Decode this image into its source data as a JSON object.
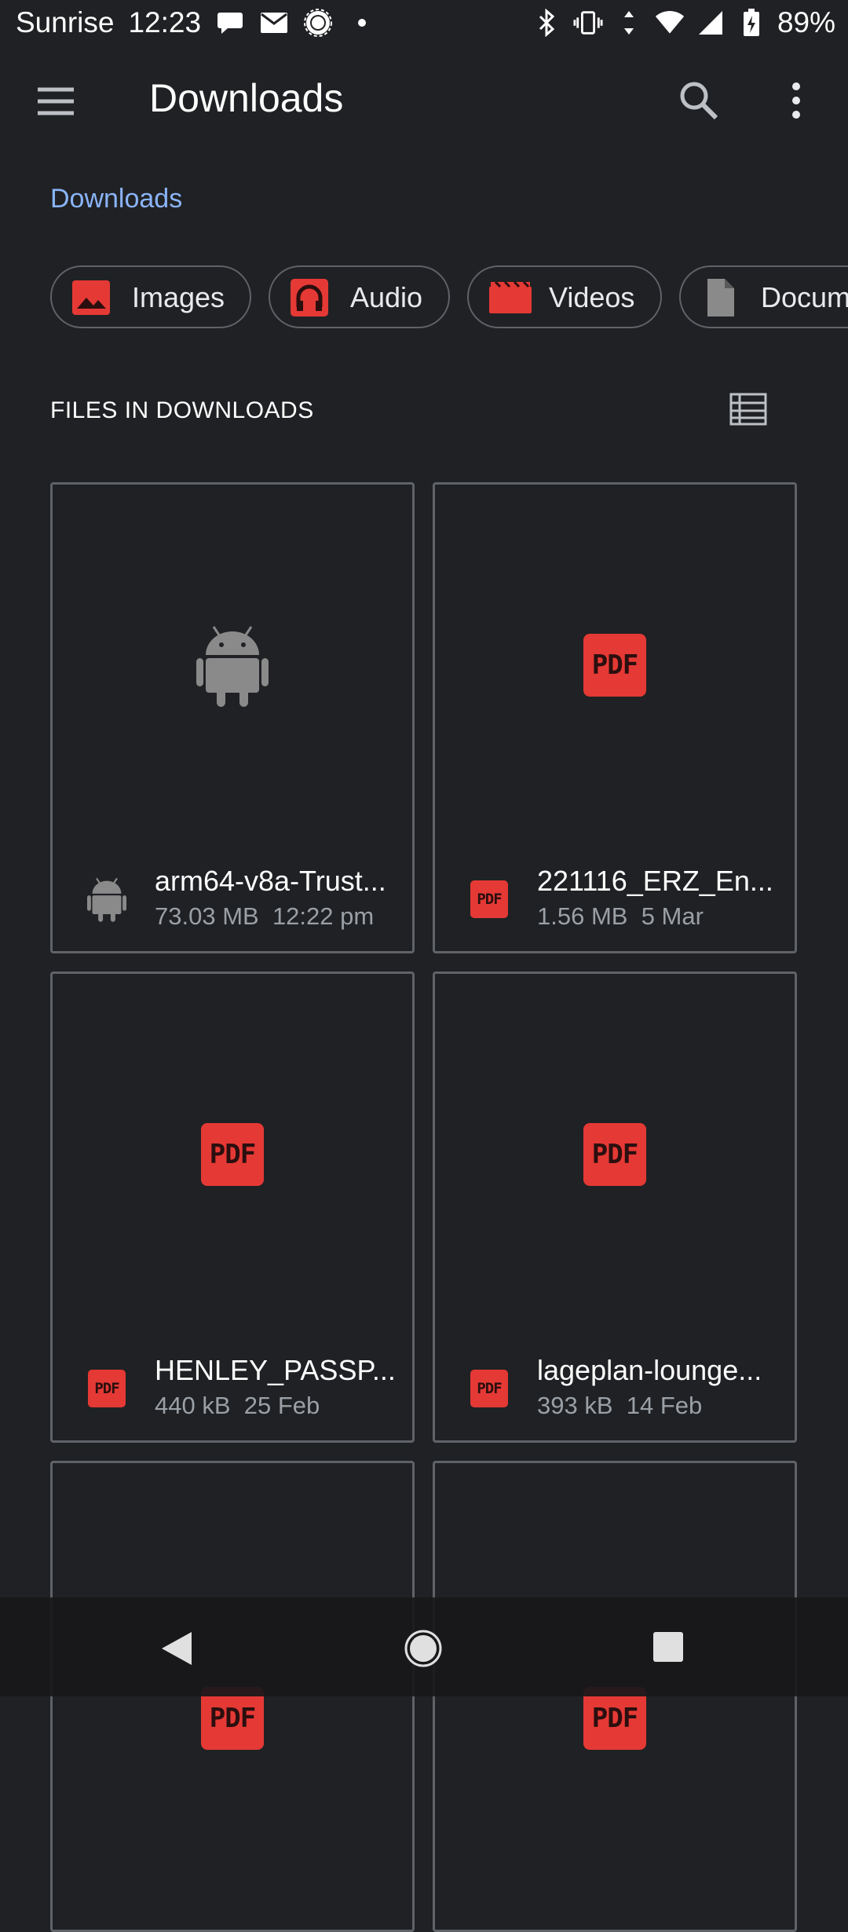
{
  "status_bar": {
    "carrier": "Sunrise",
    "time": "12:23",
    "battery": "89%"
  },
  "toolbar": {
    "title": "Downloads"
  },
  "breadcrumb": {
    "label": "Downloads"
  },
  "chips": [
    {
      "label": "Images",
      "icon": "image-icon",
      "color": "#e53935"
    },
    {
      "label": "Audio",
      "icon": "headphones-icon",
      "color": "#e53935"
    },
    {
      "label": "Videos",
      "icon": "movie-icon",
      "color": "#e53935"
    },
    {
      "label": "Docum",
      "icon": "document-icon",
      "color": "#8a8a8a"
    }
  ],
  "section": {
    "title": "FILES IN DOWNLOADS"
  },
  "files": [
    {
      "name": "arm64-v8a-Trust...",
      "size": "73.03 MB",
      "date": "12:22 pm",
      "type": "android"
    },
    {
      "name": "221116_ERZ_En...",
      "size": "1.56 MB",
      "date": "5 Mar",
      "type": "pdf"
    },
    {
      "name": "HENLEY_PASSP...",
      "size": "440 kB",
      "date": "25 Feb",
      "type": "pdf"
    },
    {
      "name": "lageplan-lounge...",
      "size": "393 kB",
      "date": "14 Feb",
      "type": "pdf"
    },
    {
      "name": "",
      "size": "",
      "date": "",
      "type": "pdf"
    },
    {
      "name": "",
      "size": "",
      "date": "",
      "type": "pdf"
    }
  ],
  "pdf_badge": "PDF",
  "colors": {
    "background": "#202124",
    "accent_link": "#8ab4f8",
    "pdf_red": "#e53935",
    "card_border": "#5f6368"
  }
}
